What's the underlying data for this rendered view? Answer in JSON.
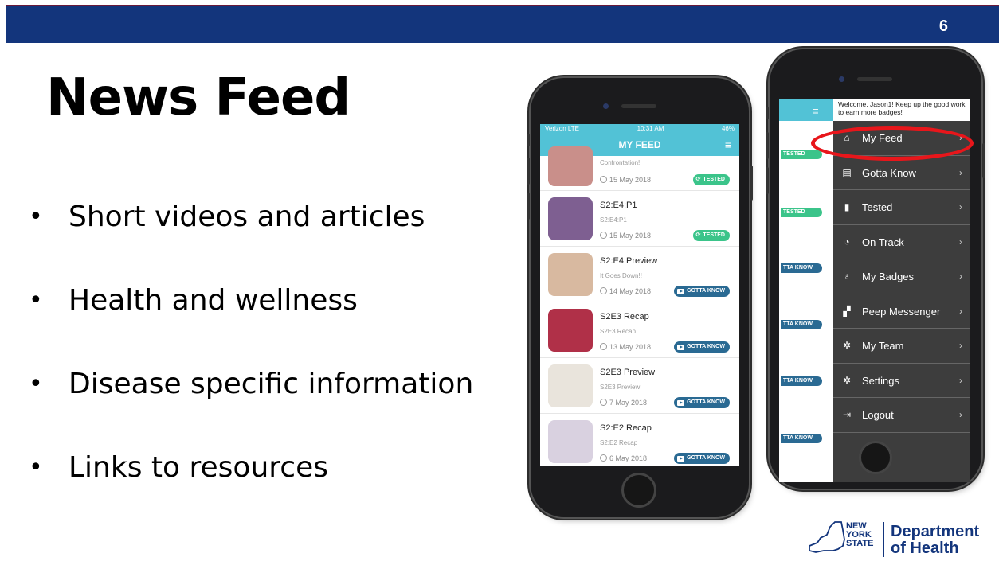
{
  "slide": {
    "number": "6",
    "title": "News Feed",
    "bullets": [
      "Short videos and articles",
      "Health and wellness",
      "Disease specific information",
      "Links to resources"
    ]
  },
  "phone1": {
    "status": {
      "carrier": "Verizon LTE",
      "time": "10:31 AM",
      "battery": "46%"
    },
    "header": "MY FEED",
    "items": [
      {
        "title": "",
        "subtitle": "Confrontation!",
        "date": "15 May 2018",
        "badge": "TESTED",
        "badge_type": "tested",
        "thumb_color": "#c98f8a"
      },
      {
        "title": "S2:E4:P1",
        "subtitle": "S2:E4:P1",
        "date": "15 May 2018",
        "badge": "TESTED",
        "badge_type": "tested",
        "thumb_color": "#7e5f91"
      },
      {
        "title": "S2:E4 Preview",
        "subtitle": "It Goes Down!!",
        "date": "14 May 2018",
        "badge": "GOTTA KNOW",
        "badge_type": "gotta",
        "thumb_color": "#d8b9a0"
      },
      {
        "title": "S2E3 Recap",
        "subtitle": "S2E3 Recap",
        "date": "13 May 2018",
        "badge": "GOTTA KNOW",
        "badge_type": "gotta",
        "thumb_color": "#b03048"
      },
      {
        "title": "S2E3 Preview",
        "subtitle": "S2E3 Preview",
        "date": "7 May 2018",
        "badge": "GOTTA KNOW",
        "badge_type": "gotta",
        "thumb_color": "#e9e4dc"
      },
      {
        "title": "S2:E2 Recap",
        "subtitle": "S2:E2 Recap",
        "date": "6 May 2018",
        "badge": "GOTTA KNOW",
        "badge_type": "gotta",
        "thumb_color": "#d9d1e0"
      }
    ]
  },
  "phone2": {
    "welcome": "Welcome, Jason1! Keep up the good work to earn more badges!",
    "peek_badges": [
      {
        "label": "TESTED",
        "type": "tested"
      },
      {
        "label": "TESTED",
        "type": "tested"
      },
      {
        "label": "TTA KNOW",
        "type": "gotta"
      },
      {
        "label": "TTA KNOW",
        "type": "gotta"
      },
      {
        "label": "TTA KNOW",
        "type": "gotta"
      },
      {
        "label": "TTA KNOW",
        "type": "gotta"
      }
    ],
    "menu": [
      {
        "label": "My Feed",
        "icon": "home-icon",
        "glyph": "⌂"
      },
      {
        "label": "Gotta Know",
        "icon": "document-icon",
        "glyph": "▤"
      },
      {
        "label": "Tested",
        "icon": "book-icon",
        "glyph": "▮"
      },
      {
        "label": "On Track",
        "icon": "clock-icon",
        "glyph": "◔"
      },
      {
        "label": "My Badges",
        "icon": "badge-icon",
        "glyph": "♁"
      },
      {
        "label": "Peep Messenger",
        "icon": "chat-icon",
        "glyph": "▞"
      },
      {
        "label": "My Team",
        "icon": "gear-icon",
        "glyph": "✲"
      },
      {
        "label": "Settings",
        "icon": "gear-icon",
        "glyph": "✲"
      },
      {
        "label": "Logout",
        "icon": "logout-icon",
        "glyph": "⇥"
      }
    ]
  },
  "logo": {
    "state_line1": "NEW",
    "state_line2": "YORK",
    "state_line3": "STATE",
    "dept_line1": "Department",
    "dept_line2": "of Health"
  },
  "colors": {
    "banner": "#13357c",
    "accent_teal": "#52c2d6",
    "tested_green": "#3bc48a",
    "gotta_blue": "#2a6a93",
    "highlight_red": "#e8161b"
  }
}
